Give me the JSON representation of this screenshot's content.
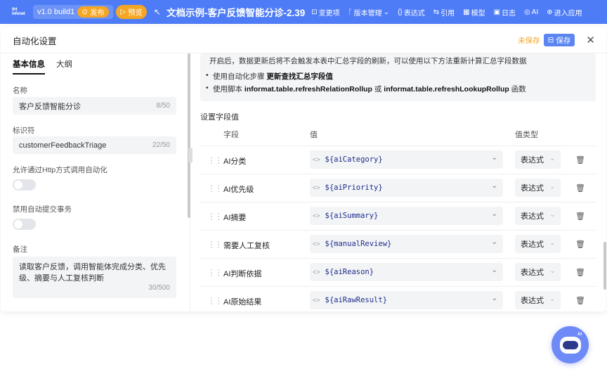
{
  "topbar": {
    "logo": "0H Infonet",
    "version": "v1.0 build1",
    "publish": "发布",
    "preview": "预览",
    "title": "文档示例-客户反馈智能分诊-2.39",
    "menu": [
      "变更项",
      "版本管理",
      "表达式",
      "引用",
      "模型",
      "日志",
      "AI",
      "进入应用"
    ]
  },
  "modal": {
    "title": "自动化设置",
    "unsaved": "未保存",
    "save": "保存"
  },
  "left": {
    "tabs": [
      "基本信息",
      "大纲"
    ],
    "name_label": "名称",
    "name_value": "客户反馈智能分诊",
    "name_count": "8/50",
    "id_label": "标识符",
    "id_value": "customerFeedbackTriage",
    "id_count": "22/50",
    "http_label": "允许通过Http方式调用自动化",
    "tx_label": "禁用自动提交事务",
    "remark_label": "备注",
    "remark_value": "读取客户反馈，调用智能体完成分类、优先级、摘要与人工复核判断",
    "remark_count": "30/500"
  },
  "notice": {
    "line1": "开启后，数据更新后将不会触发本表中汇总字段的刷新，可以使用以下方法重新计算汇总字段数据",
    "b1_pre": "使用自动化步骤 ",
    "b1_bold": "更新查找汇总字段值",
    "b2_pre": "使用脚本 ",
    "b2_bold1": "informat.table.refreshRelationRollup",
    "b2_mid": " 或 ",
    "b2_bold2": "informat.table.refreshLookupRollup",
    "b2_post": " 函数"
  },
  "section": "设置字段值",
  "columns": {
    "field": "字段",
    "value": "值",
    "type": "值类型"
  },
  "rows": [
    {
      "field": "AI分类",
      "value": "${aiCategory}",
      "type": "表达式"
    },
    {
      "field": "AI优先级",
      "value": "${aiPriority}",
      "type": "表达式"
    },
    {
      "field": "AI摘要",
      "value": "${aiSummary}",
      "type": "表达式"
    },
    {
      "field": "需要人工复核",
      "value": "${manualReview}",
      "type": "表达式"
    },
    {
      "field": "AI判断依据",
      "value": "${aiReason}",
      "type": "表达式"
    },
    {
      "field": "AI原始结果",
      "value": "${aiRawResult}",
      "type": "表达式"
    }
  ]
}
